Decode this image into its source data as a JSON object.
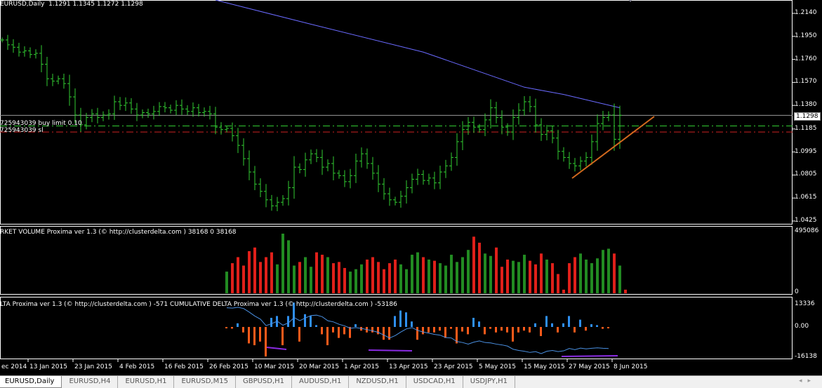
{
  "header": {
    "symbol": "EURUSD,Daily",
    "ohlc": "1.1291 1.1345 1.1272 1.1298"
  },
  "orders": {
    "buy_limit": "725943039 buy limit 0.10",
    "sl": "725943039 sl",
    "buy_limit_price": 1.121,
    "sl_price": 1.116
  },
  "price_axis": {
    "ticks": [
      "1.2140",
      "1.1950",
      "1.1760",
      "1.1570",
      "1.1380",
      "1.1185",
      "1.0995",
      "1.0805",
      "1.0615",
      "1.0425"
    ],
    "current": "1.1298"
  },
  "volume_pane": {
    "title": "RKET VOLUME Proxima ver 1.3 (© http://clusterdelta.com ) 38168 0 38168",
    "max": "495086",
    "min": "0"
  },
  "delta_pane": {
    "title": "LTA Proxima ver 1.3 (© http://clusterdelta.com ) -571  CUMULATIVE DELTA Proxima ver 1.3 (© http://clusterdelta.com ) -53186",
    "max": "13336",
    "zero": "0.00",
    "min": "-16138"
  },
  "dates": [
    "ec 2014",
    "13 Jan 2015",
    "23 Jan 2015",
    "4 Feb 2015",
    "16 Feb 2015",
    "26 Feb 2015",
    "10 Mar 2015",
    "20 Mar 2015",
    "1 Apr 2015",
    "13 Apr 2015",
    "23 Apr 2015",
    "5 May 2015",
    "15 May 2015",
    "27 May 2015",
    "8 Jun 2015"
  ],
  "tabs": [
    "EURUSD,Daily",
    "EURUSD,H4",
    "EURUSD,H1",
    "EURUSD,M15",
    "GBPUSD,H1",
    "AUDUSD,H1",
    "NZDUSD,H1",
    "USDCAD,H1",
    "USDJPY,H1"
  ],
  "colors": {
    "bars": "#32cd32",
    "ma": "#6a6aff",
    "up": "#228b22",
    "down": "#e0201a",
    "pos": "#2f8ff0",
    "neg": "#ff5a1a",
    "trend": "#d2691e",
    "cum": "#4a90e2",
    "purple": "#8a2be2"
  },
  "chart_data": {
    "type": "ohlc",
    "closes": [
      1.192,
      1.188,
      1.186,
      1.182,
      1.183,
      1.18,
      1.181,
      1.172,
      1.16,
      1.158,
      1.16,
      1.156,
      1.145,
      1.13,
      1.122,
      1.128,
      1.131,
      1.128,
      1.13,
      1.131,
      1.141,
      1.138,
      1.14,
      1.135,
      1.13,
      1.132,
      1.131,
      1.133,
      1.137,
      1.136,
      1.134,
      1.138,
      1.135,
      1.133,
      1.136,
      1.132,
      1.133,
      1.131,
      1.12,
      1.118,
      1.119,
      1.113,
      1.105,
      1.094,
      1.083,
      1.073,
      1.067,
      1.06,
      1.055,
      1.058,
      1.061,
      1.07,
      1.087,
      1.085,
      1.093,
      1.098,
      1.095,
      1.087,
      1.09,
      1.082,
      1.08,
      1.075,
      1.08,
      1.092,
      1.098,
      1.09,
      1.082,
      1.073,
      1.065,
      1.06,
      1.058,
      1.063,
      1.07,
      1.077,
      1.081,
      1.076,
      1.078,
      1.074,
      1.083,
      1.088,
      1.095,
      1.108,
      1.118,
      1.124,
      1.12,
      1.118,
      1.126,
      1.136,
      1.128,
      1.12,
      1.116,
      1.128,
      1.134,
      1.141,
      1.137,
      1.122,
      1.114,
      1.117,
      1.111,
      1.1,
      1.095,
      1.09,
      1.088,
      1.092,
      1.095,
      1.108,
      1.123,
      1.128,
      1.13,
      1.11,
      1.1298
    ],
    "ma": [
      [
        38,
        1.225
      ],
      [
        55,
        1.205
      ],
      [
        75,
        1.182
      ],
      [
        93,
        1.153
      ],
      [
        100,
        1.147
      ],
      [
        110,
        1.136
      ]
    ],
    "volume_start": 40,
    "volume": [
      180000,
      250000,
      300000,
      230000,
      350000,
      380000,
      260000,
      300000,
      340000,
      240000,
      495086,
      440000,
      230000,
      260000,
      300000,
      220000,
      340000,
      320000,
      300000,
      250000,
      260000,
      210000,
      180000,
      200000,
      240000,
      280000,
      300000,
      260000,
      200000,
      250000,
      280000,
      240000,
      200000,
      320000,
      340000,
      300000,
      280000,
      270000,
      250000,
      230000,
      320000,
      260000,
      300000,
      360000,
      470000,
      420000,
      330000,
      310000,
      380000,
      220000,
      280000,
      270000,
      260000,
      320000,
      270000,
      240000,
      330000,
      280000,
      250000,
      160000,
      30000,
      250000,
      300000,
      330000,
      280000,
      250000,
      290000,
      360000,
      370000,
      330000,
      230000,
      30000
    ],
    "delta": [
      -571,
      -900,
      2000,
      -3000,
      -9000,
      -10000,
      -8000,
      -16138,
      5000,
      6000,
      -10000,
      6000,
      13336,
      -8000,
      7000,
      6000,
      1000,
      -4000,
      -10000,
      -3000,
      -6000,
      -4000,
      -6000,
      1500,
      -2000,
      -3000,
      -3000,
      -4000,
      -7000,
      -7000,
      6000,
      9000,
      8000,
      3000,
      -7000,
      -4000,
      -3000,
      -3000,
      -2000,
      -6000,
      -1000,
      -9000,
      -2500,
      -4000,
      5000,
      3000,
      -4000,
      -1000,
      -3000,
      -2000,
      -3000,
      -8000,
      -3000,
      -2000,
      -3000,
      2000,
      -5000,
      6000,
      2000,
      -3000,
      2000,
      6000,
      -3000,
      4000,
      -2000,
      1500,
      1000,
      -1000,
      -571
    ]
  }
}
